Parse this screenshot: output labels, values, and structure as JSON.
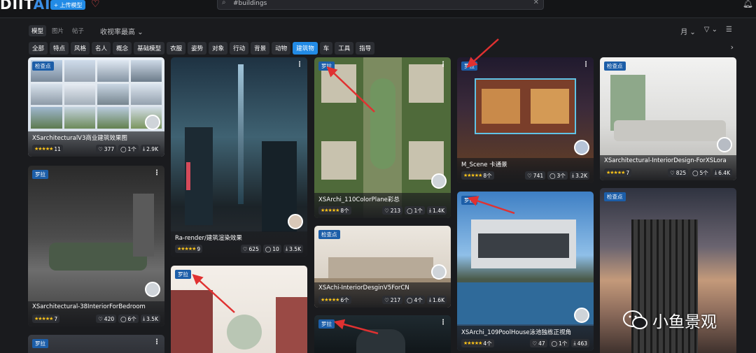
{
  "header": {
    "logo_main": "DIIT",
    "logo_ai": "AI",
    "upload_label": "上传模型",
    "search_value": "#buildings"
  },
  "view_toggle": [
    "模型",
    "图片",
    "帖子"
  ],
  "sort_label": "收视率最高",
  "right_controls": {
    "period": "月",
    "filter": "▽"
  },
  "tags": [
    "全部",
    "特点",
    "风格",
    "名人",
    "概念",
    "基础模型",
    "衣服",
    "姿势",
    "对象",
    "行动",
    "背景",
    "动物",
    "建筑物",
    "车",
    "工具",
    "指导"
  ],
  "active_tag": "建筑物",
  "cards": [
    {
      "name": "XSarchitecturalV3商业建筑效果图",
      "badge": "检查点",
      "rating": "11",
      "likes": "377",
      "comments": "1个",
      "downloads": "2.9K"
    },
    {
      "name": "XSarchitectural-38InteriorForBedroom",
      "badge": "罗拉",
      "rating": "7",
      "likes": "420",
      "comments": "6个",
      "downloads": "3.5K"
    },
    {
      "name": "",
      "badge": "罗拉"
    },
    {
      "name": "Ra-render/建筑渲染效果",
      "badge": "",
      "rating": "9",
      "likes": "625",
      "comments": "10",
      "downloads": "3.5K"
    },
    {
      "name": "",
      "badge": "罗拉"
    },
    {
      "name": "XSArchi_110ColorPlane彩总",
      "badge": "罗拉",
      "rating": "8个",
      "likes": "213",
      "comments": "1个",
      "downloads": "1.4K"
    },
    {
      "name": "XSAchi-InteriorDesginV5ForCN",
      "badge": "检查点",
      "rating": "6个",
      "likes": "217",
      "comments": "4个",
      "downloads": "1.6K"
    },
    {
      "name": "",
      "badge": "罗拉"
    },
    {
      "name": "M_Scene 卡通景",
      "badge": "罗拉",
      "rating": "8个",
      "likes": "741",
      "comments": "3个",
      "downloads": "3.2K"
    },
    {
      "name": "XSArchi_109PoolHouse泳池独栋正视角",
      "badge": "罗拉",
      "rating": "4个",
      "likes": "47",
      "comments": "1个",
      "downloads": "463"
    },
    {
      "name": "XSarchitectural-InteriorDesign-ForXSLora",
      "badge": "检查点",
      "rating": "7",
      "likes": "825",
      "comments": "5个",
      "downloads": "6.4K"
    },
    {
      "name": "",
      "badge": "检查点"
    }
  ],
  "watermark": "小鱼景观",
  "icons": {
    "search": "search-icon",
    "clear": "close-icon",
    "bell": "bell-icon",
    "heart": "heart-icon",
    "more": "more-vertical-icon",
    "star": "star-icon",
    "like": "heart-outline-icon",
    "comment": "comment-icon",
    "download": "download-icon",
    "chevron": "chevron-down-icon",
    "filter": "filter-icon",
    "layout": "layout-icon",
    "next": "chevron-right-icon"
  },
  "colors": {
    "accent": "#228be6",
    "badge": "#1c5ea8",
    "star": "#fcc419",
    "arrow": "#e03131",
    "bg": "#1a1b1e"
  }
}
